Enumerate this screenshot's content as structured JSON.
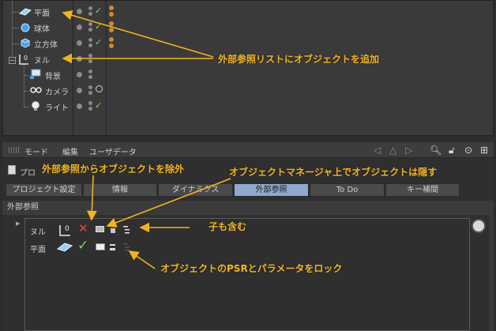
{
  "object_manager": {
    "objects": [
      {
        "name": "平面",
        "icon": "plane-icon"
      },
      {
        "name": "球体",
        "icon": "sphere-icon"
      },
      {
        "name": "立方体",
        "icon": "cube-icon"
      },
      {
        "name": "ヌル",
        "icon": "null-icon"
      },
      {
        "name": "背景",
        "icon": "background-icon"
      },
      {
        "name": "カメラ",
        "icon": "camera-icon"
      },
      {
        "name": "ライト",
        "icon": "light-icon"
      }
    ]
  },
  "attribute_manager": {
    "menu": [
      "モード",
      "編集",
      "ユーザデータ"
    ],
    "object_label": "プロ",
    "tabs": [
      {
        "label": "プロジェクト設定",
        "active": false
      },
      {
        "label": "情報",
        "active": false
      },
      {
        "label": "ダイナミクス",
        "active": false
      },
      {
        "label": "外部参照",
        "active": true
      },
      {
        "label": "To Do",
        "active": false
      },
      {
        "label": "キー補間",
        "active": false
      }
    ],
    "section_title": "外部参照",
    "xref_list": [
      {
        "name": "ヌル",
        "icon": "null-icon"
      },
      {
        "name": "平面",
        "icon": "plane-icon"
      }
    ]
  },
  "annotations": {
    "add": "外部参照リストにオブジェクトを追加",
    "remove": "外部参照からオブジェクトを除外",
    "hide": "オブジェクトマネージャ上でオブジェクトは隠す",
    "children": "子も含む",
    "lock": "オブジェクトのPSRとパラメータをロック"
  },
  "colors": {
    "annotation": "#f2b320",
    "active_tab": "#8ea9cc",
    "check": "#7bd35a",
    "remove_x": "#e0483a"
  }
}
